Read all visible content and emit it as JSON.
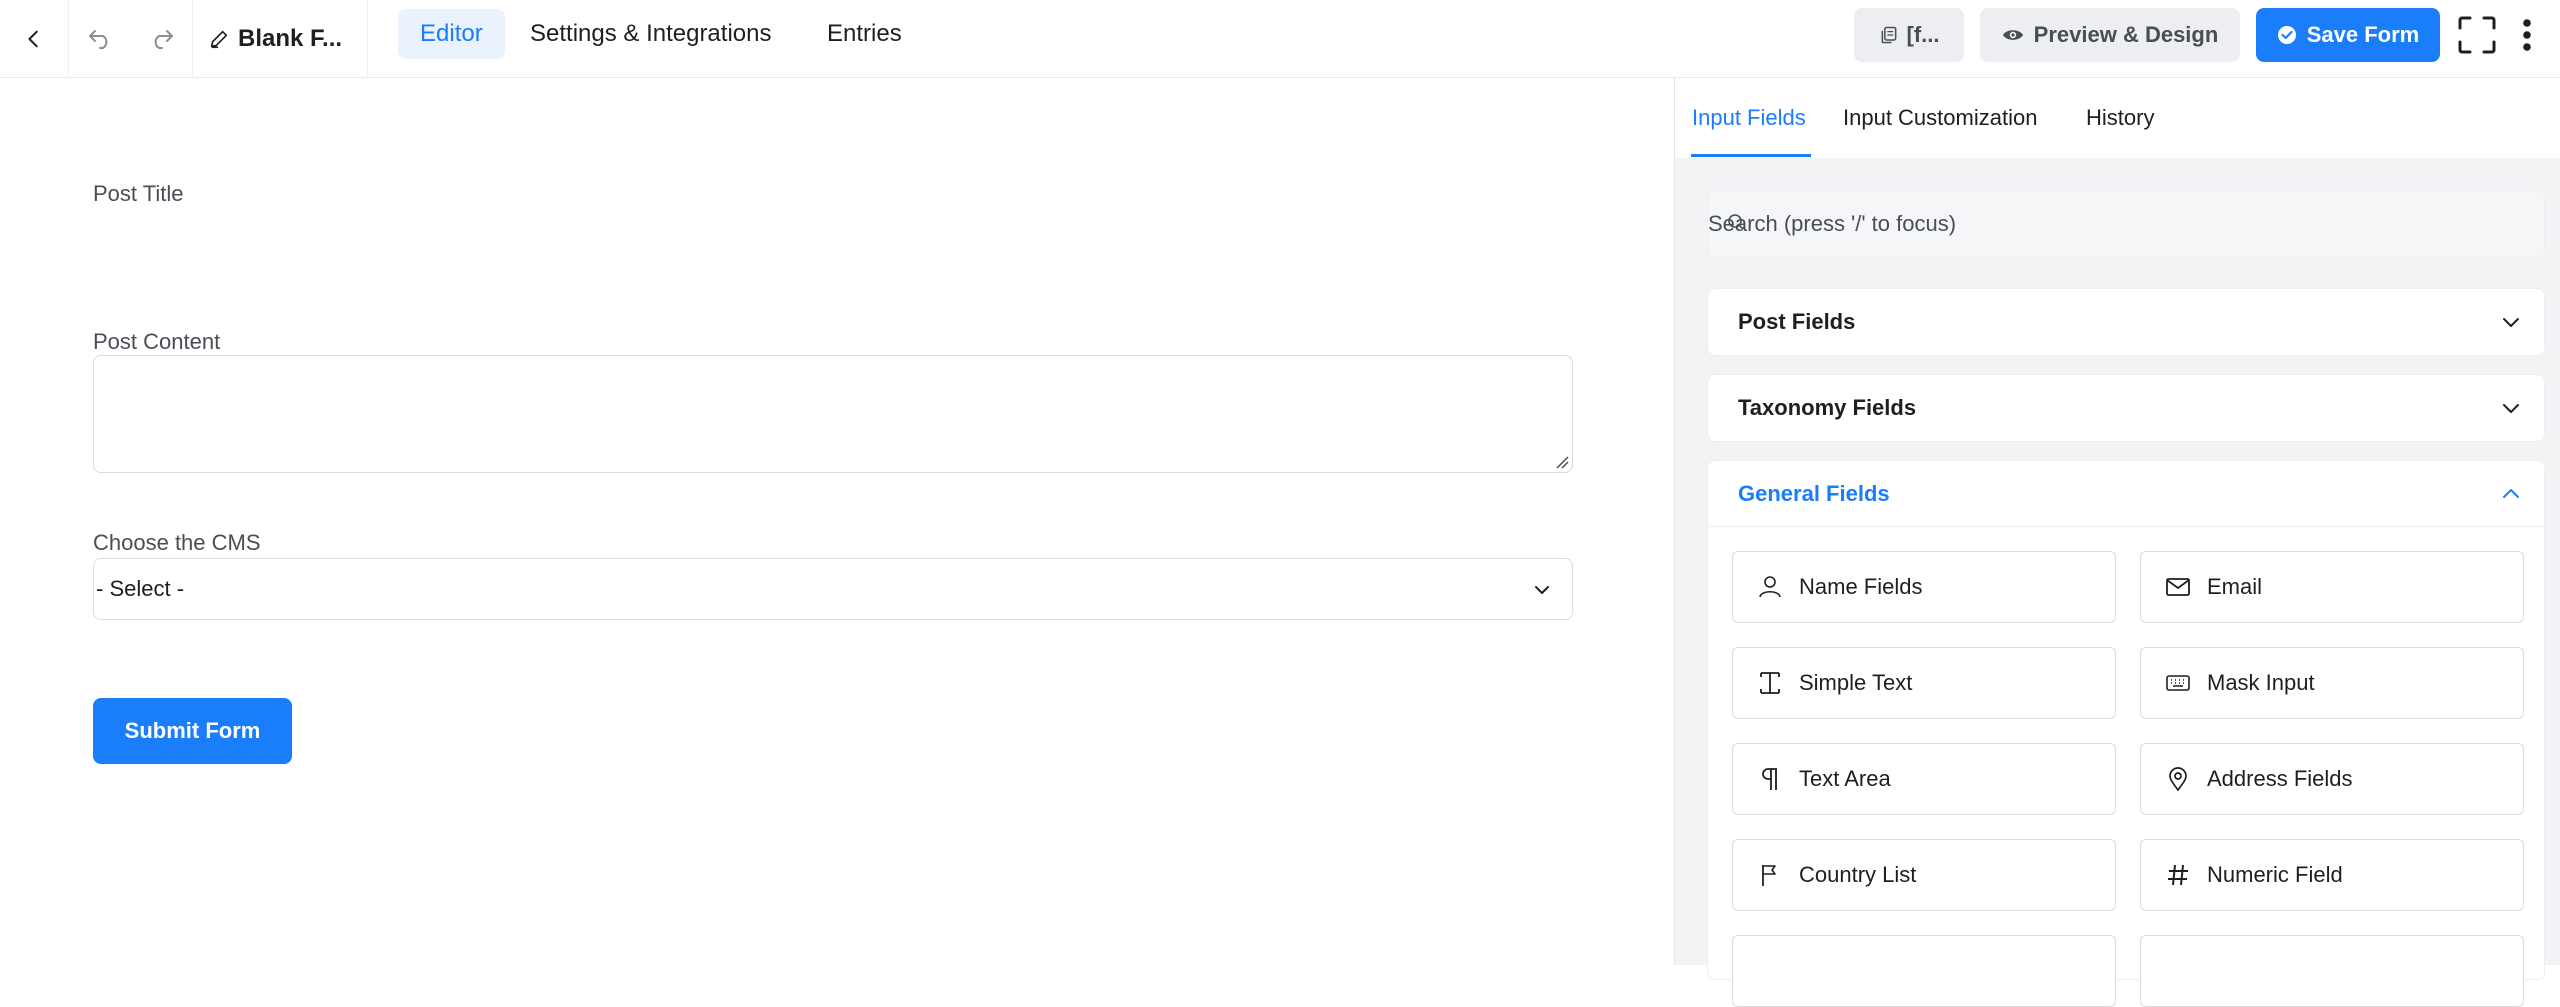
{
  "topbar": {
    "form_name": "Blank F...",
    "tabs": [
      {
        "label": "Editor",
        "active": true
      },
      {
        "label": "Settings & Integrations",
        "active": false
      },
      {
        "label": "Entries",
        "active": false
      }
    ],
    "shortcode_label": "[f...",
    "preview_label": "Preview & Design",
    "save_label": "Save Form"
  },
  "form": {
    "post_title_label": "Post Title",
    "post_content_label": "Post Content",
    "cms_label": "Choose the CMS",
    "cms_select_value": "- Select -",
    "submit_label": "Submit Form"
  },
  "panel": {
    "tabs": [
      {
        "label": "Input Fields",
        "active": true
      },
      {
        "label": "Input Customization",
        "active": false
      },
      {
        "label": "History",
        "active": false
      }
    ],
    "search_placeholder": "Search (press '/' to focus)",
    "groups": [
      {
        "label": "Post Fields",
        "expanded": false
      },
      {
        "label": "Taxonomy Fields",
        "expanded": false
      },
      {
        "label": "General Fields",
        "expanded": true
      }
    ],
    "general_fields": [
      {
        "label": "Name Fields",
        "icon": "person-icon"
      },
      {
        "label": "Email",
        "icon": "envelope-icon"
      },
      {
        "label": "Simple Text",
        "icon": "text-cursor-icon"
      },
      {
        "label": "Mask Input",
        "icon": "keyboard-icon"
      },
      {
        "label": "Text Area",
        "icon": "paragraph-icon"
      },
      {
        "label": "Address Fields",
        "icon": "map-pin-icon"
      },
      {
        "label": "Country List",
        "icon": "flag-icon"
      },
      {
        "label": "Numeric Field",
        "icon": "hash-icon"
      }
    ]
  },
  "colors": {
    "accent": "#1a7efb",
    "accent_light": "#e9f2fd",
    "border": "#dadbdd",
    "panel_bg": "#f2f3f5"
  }
}
